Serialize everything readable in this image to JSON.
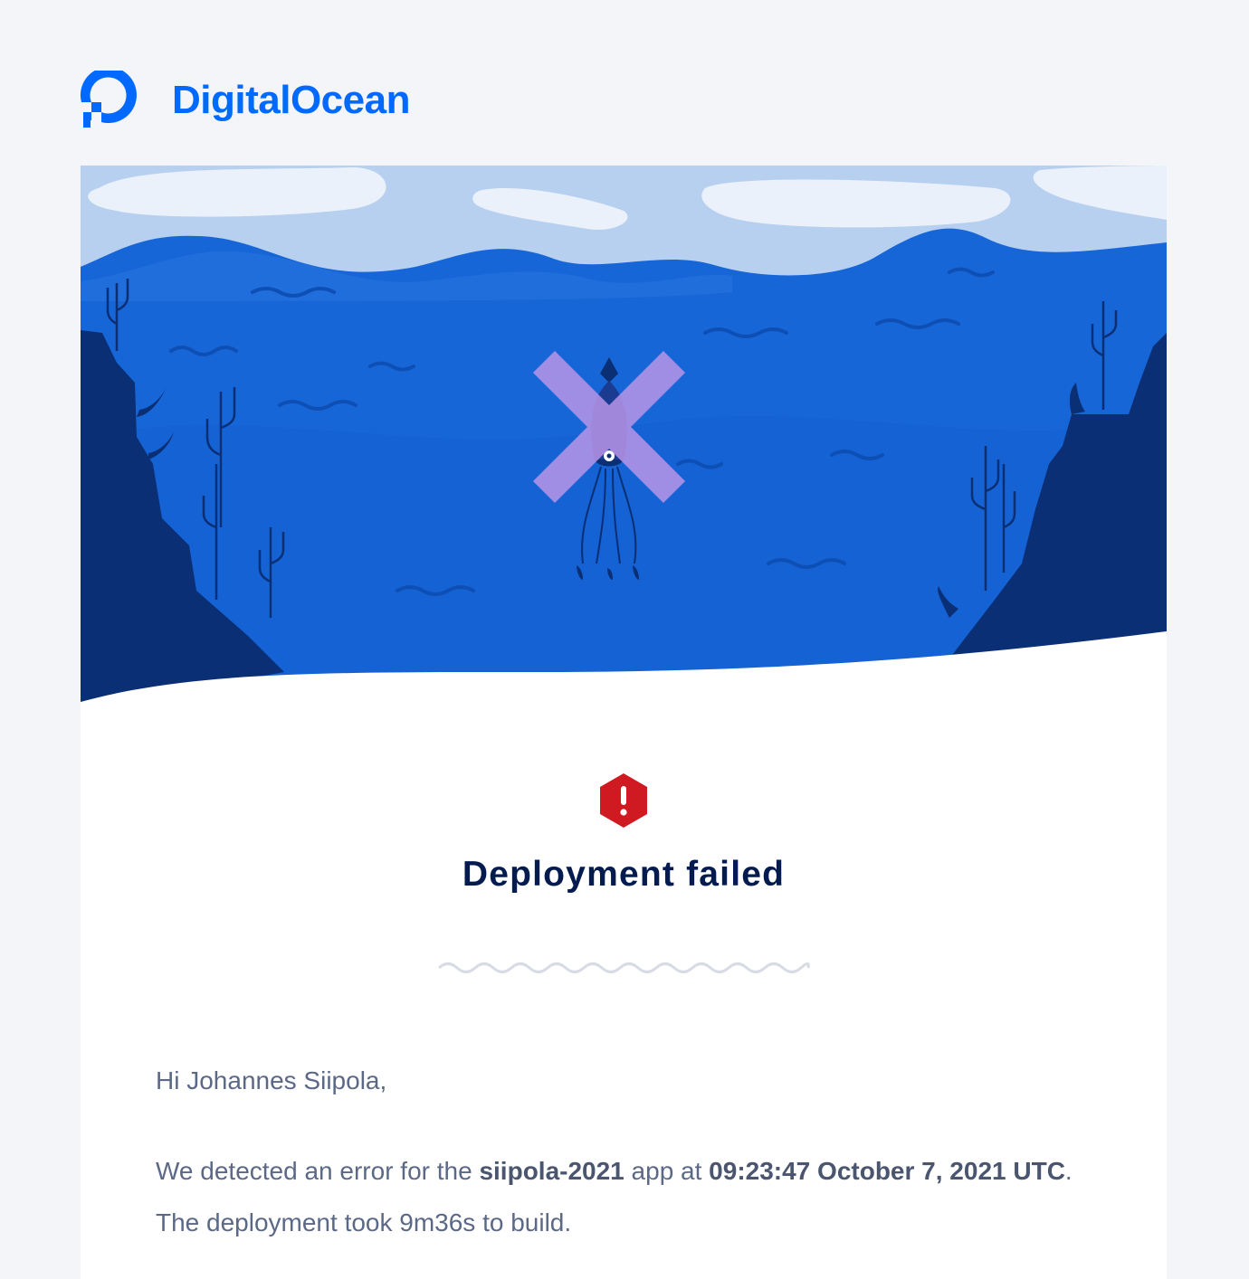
{
  "brand": {
    "name": "DigitalOcean",
    "color": "#0069ff",
    "icon": "digitalocean-logo-icon"
  },
  "hero": {
    "illustration": "underwater-squid-crossed-out",
    "colors": {
      "sky": "#b7d0f0",
      "water": "#1766d8",
      "cliffs": "#0a2f74",
      "cross": "#b995e8"
    }
  },
  "alert": {
    "icon": "error-hexagon-icon",
    "color": "#d01a22",
    "title": "Deployment failed"
  },
  "message": {
    "greeting": "Hi Johannes Siipola,",
    "line_prefix": "We detected an error for the ",
    "app_name": "siipola-2021",
    "line_middle": " app at ",
    "timestamp": "09:23:47 October 7, 2021 UTC",
    "line_suffix": ". The deployment took 9m36s to build."
  }
}
